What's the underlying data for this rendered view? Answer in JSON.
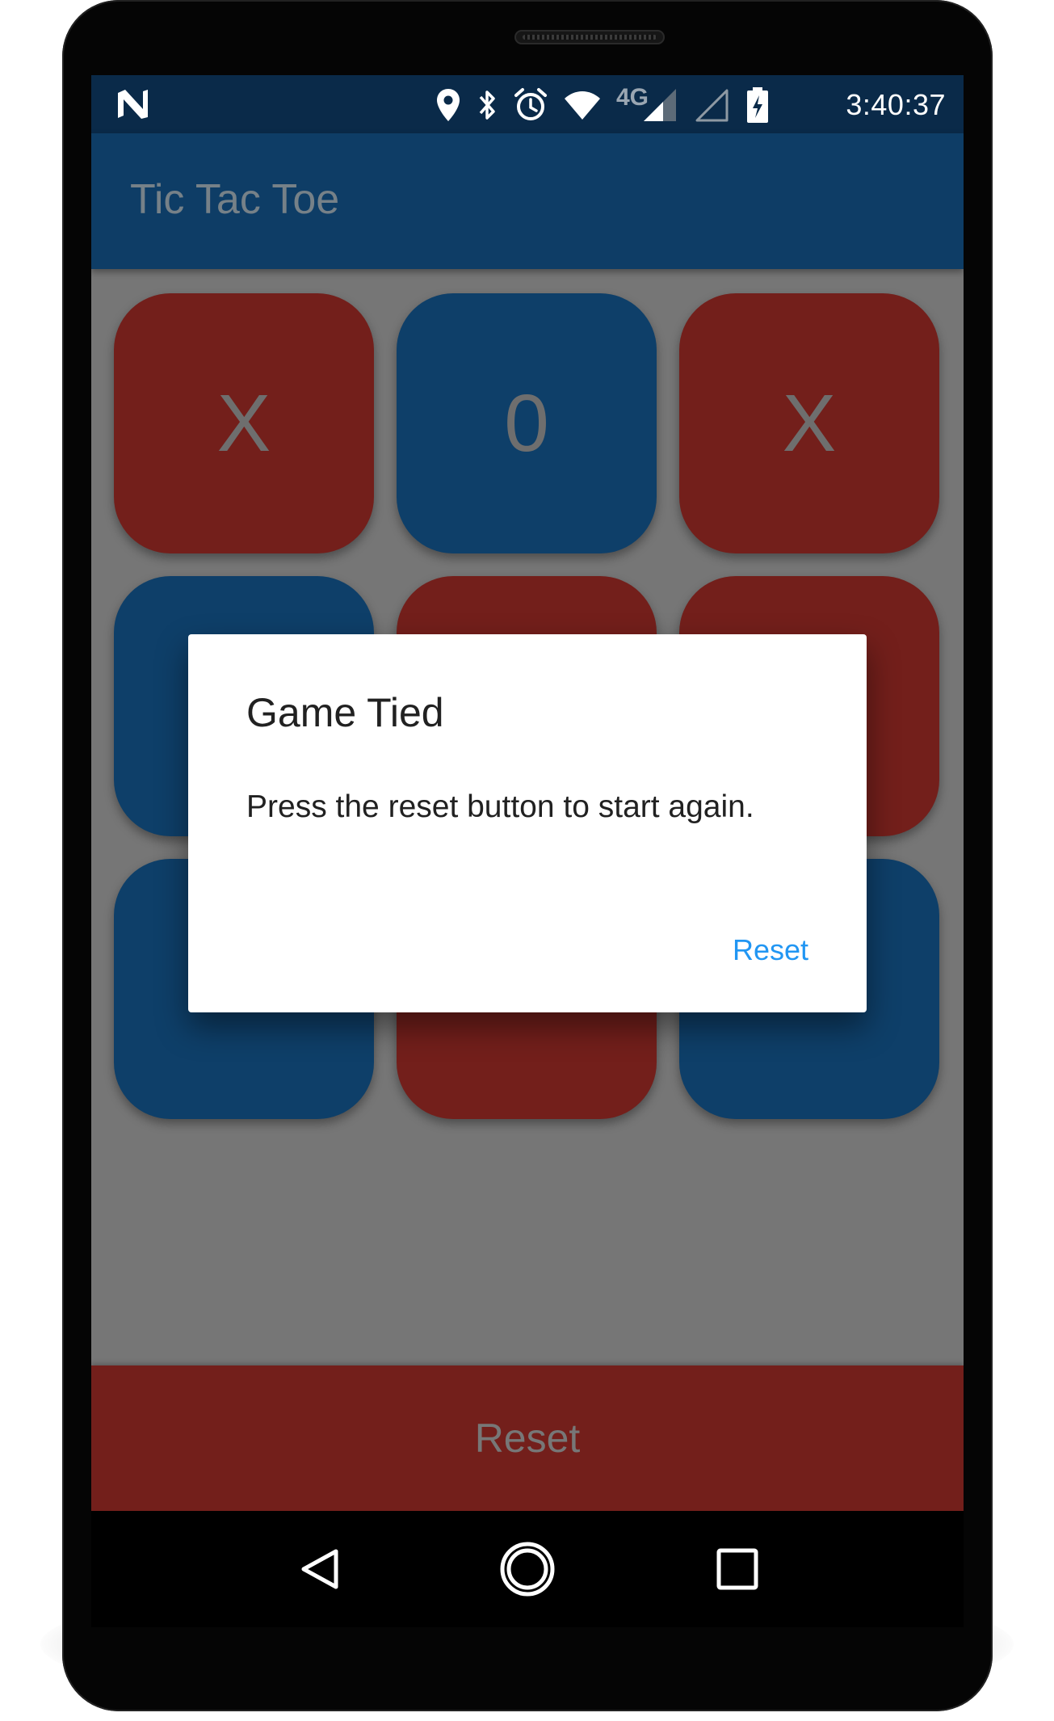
{
  "status_bar": {
    "time": "3:40:37",
    "network_label": "4G",
    "icons": [
      "notification-n-icon",
      "location-pin-icon",
      "bluetooth-icon",
      "alarm-clock-icon",
      "wifi-icon",
      "signal-strength-icon",
      "signal-empty-icon",
      "battery-charging-icon"
    ]
  },
  "app_bar": {
    "title": "Tic Tac Toe"
  },
  "board": {
    "cells": [
      {
        "mark": "X",
        "color": "red"
      },
      {
        "mark": "0",
        "color": "blue"
      },
      {
        "mark": "X",
        "color": "red"
      },
      {
        "mark": "",
        "color": "blue"
      },
      {
        "mark": "",
        "color": "red"
      },
      {
        "mark": "",
        "color": "red"
      },
      {
        "mark": "",
        "color": "blue"
      },
      {
        "mark": "",
        "color": "red"
      },
      {
        "mark": "",
        "color": "blue"
      }
    ]
  },
  "reset_bar": {
    "label": "Reset"
  },
  "dialog": {
    "title": "Game Tied",
    "message": "Press the reset button to start again.",
    "button_label": "Reset"
  },
  "nav_bar": {
    "icons": [
      "back-icon",
      "home-icon",
      "recents-icon"
    ]
  },
  "colors": {
    "red_cell": "#731f1b",
    "blue_cell": "#0e3f69",
    "app_bar": "#0e3d66",
    "status_bar": "#0a2a49",
    "dialog_accent": "#2196f3",
    "scrim_background": "#767676"
  }
}
